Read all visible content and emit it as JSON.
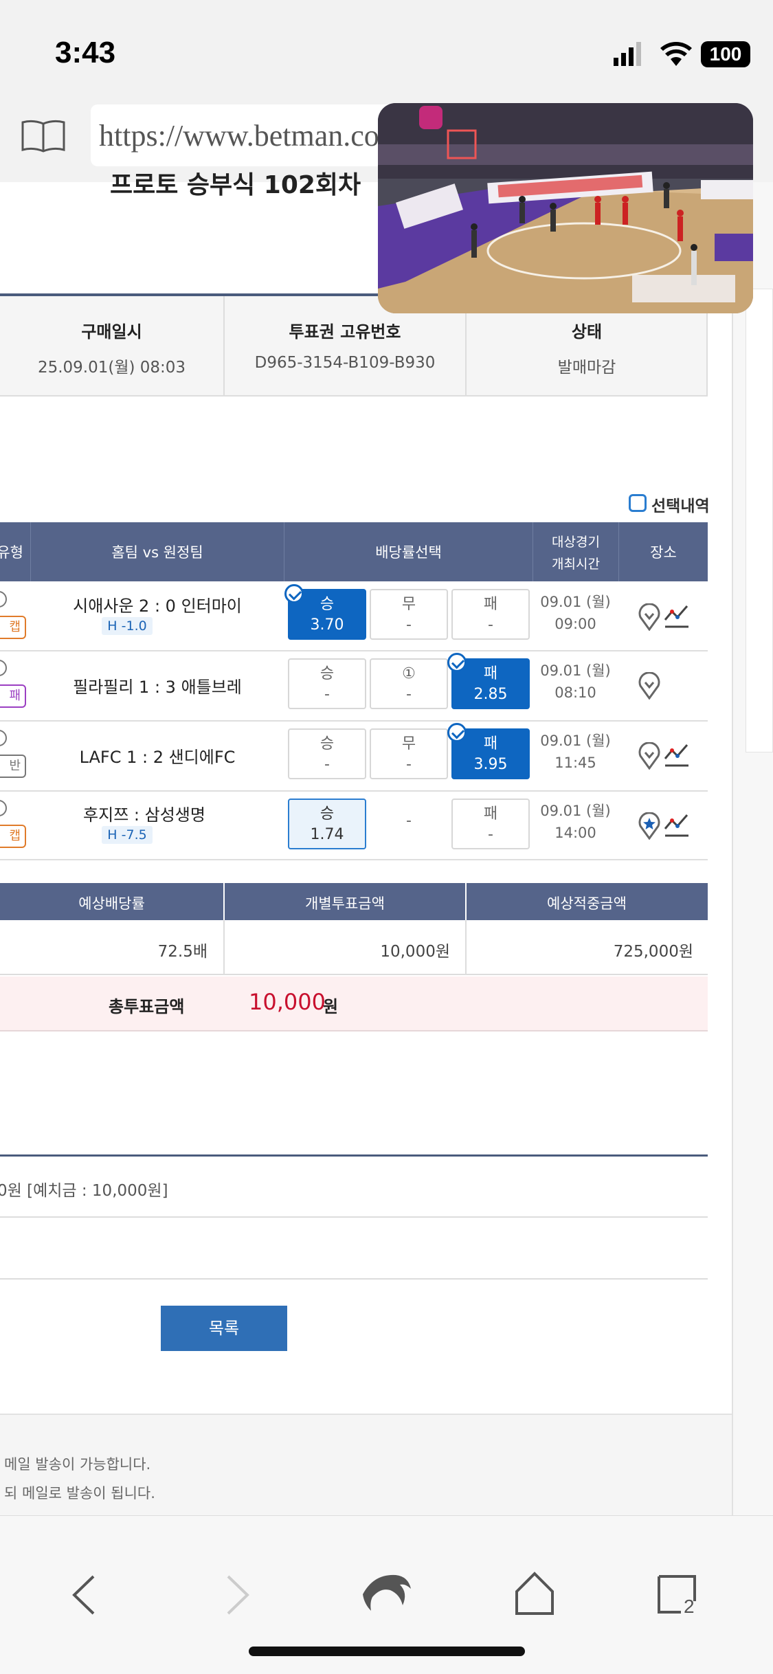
{
  "status_bar": {
    "time": "3:43",
    "battery": "100"
  },
  "browser": {
    "url": "https://www.betman.co"
  },
  "page": {
    "title_fragment": "프로토 승부식 102회차",
    "info_table": {
      "headers": [
        "구매일시",
        "투표권 고유번호",
        "상태"
      ],
      "values": [
        "25.09.01(월) 08:03",
        "D965-3154-B109-B930",
        "발매마감"
      ]
    },
    "selection_toggle": "선택내역",
    "bets_table": {
      "headers": {
        "type": "유형",
        "teams": "홈팀 vs 원정팀",
        "odds": "배당률선택",
        "time_line1": "대상경기",
        "time_line2": "개최시간",
        "venue": "장소"
      },
      "rows": [
        {
          "type_tag": "캡",
          "type_color": "#e07b2a",
          "match": "시애사운 2 : 0 인터마이",
          "handicap": "H -1.0",
          "win_label": "승",
          "win_value": "3.70",
          "draw_label": "무",
          "draw_value": "-",
          "lose_label": "패",
          "lose_value": "-",
          "date": "09.01 (월)",
          "time": "09:00",
          "selected": "win"
        },
        {
          "type_tag": "패",
          "type_color": "#9b3fc2",
          "match": "필라필리 1 : 3 애틀브레",
          "handicap": "",
          "win_label": "승",
          "win_value": "-",
          "draw_label": "①",
          "draw_value": "-",
          "lose_label": "패",
          "lose_value": "2.85",
          "date": "09.01 (월)",
          "time": "08:10",
          "selected": "lose"
        },
        {
          "type_tag": "반",
          "type_color": "#777777",
          "match": "LAFC 1 : 2 샌디에FC",
          "handicap": "",
          "win_label": "승",
          "win_value": "-",
          "draw_label": "무",
          "draw_value": "-",
          "lose_label": "패",
          "lose_value": "3.95",
          "date": "09.01 (월)",
          "time": "11:45",
          "selected": "lose"
        },
        {
          "type_tag": "캡",
          "type_color": "#e07b2a",
          "match": "후지쯔 : 삼성생명",
          "handicap": "H -7.5",
          "win_label": "승",
          "win_value": "1.74",
          "draw_label": "",
          "draw_value": "-",
          "lose_label": "패",
          "lose_value": "-",
          "date": "09.01 (월)",
          "time": "14:00",
          "selected": "win_highlight"
        }
      ]
    },
    "summary_table": {
      "headers": [
        "예상배당률",
        "개별투표금액",
        "예상적중금액"
      ],
      "values": [
        "72.5배",
        "10,000원",
        "725,000원"
      ],
      "total_label": "총투표금액",
      "total_amount": "10,000",
      "total_unit": "원"
    },
    "deposit_text": "0원 [예치금 : 10,000원]",
    "list_button": "목록",
    "footer_line1": "메일 발송이 가능합니다.",
    "footer_line2": "되 메일로 발송이 됩니다."
  },
  "bottom_nav": {
    "tabs_count": "2"
  },
  "colors": {
    "header_bg": "#55648a",
    "selected_blue": "#0e66c1",
    "total_red": "#c8102e",
    "total_row_bg": "#fdf0f1"
  }
}
